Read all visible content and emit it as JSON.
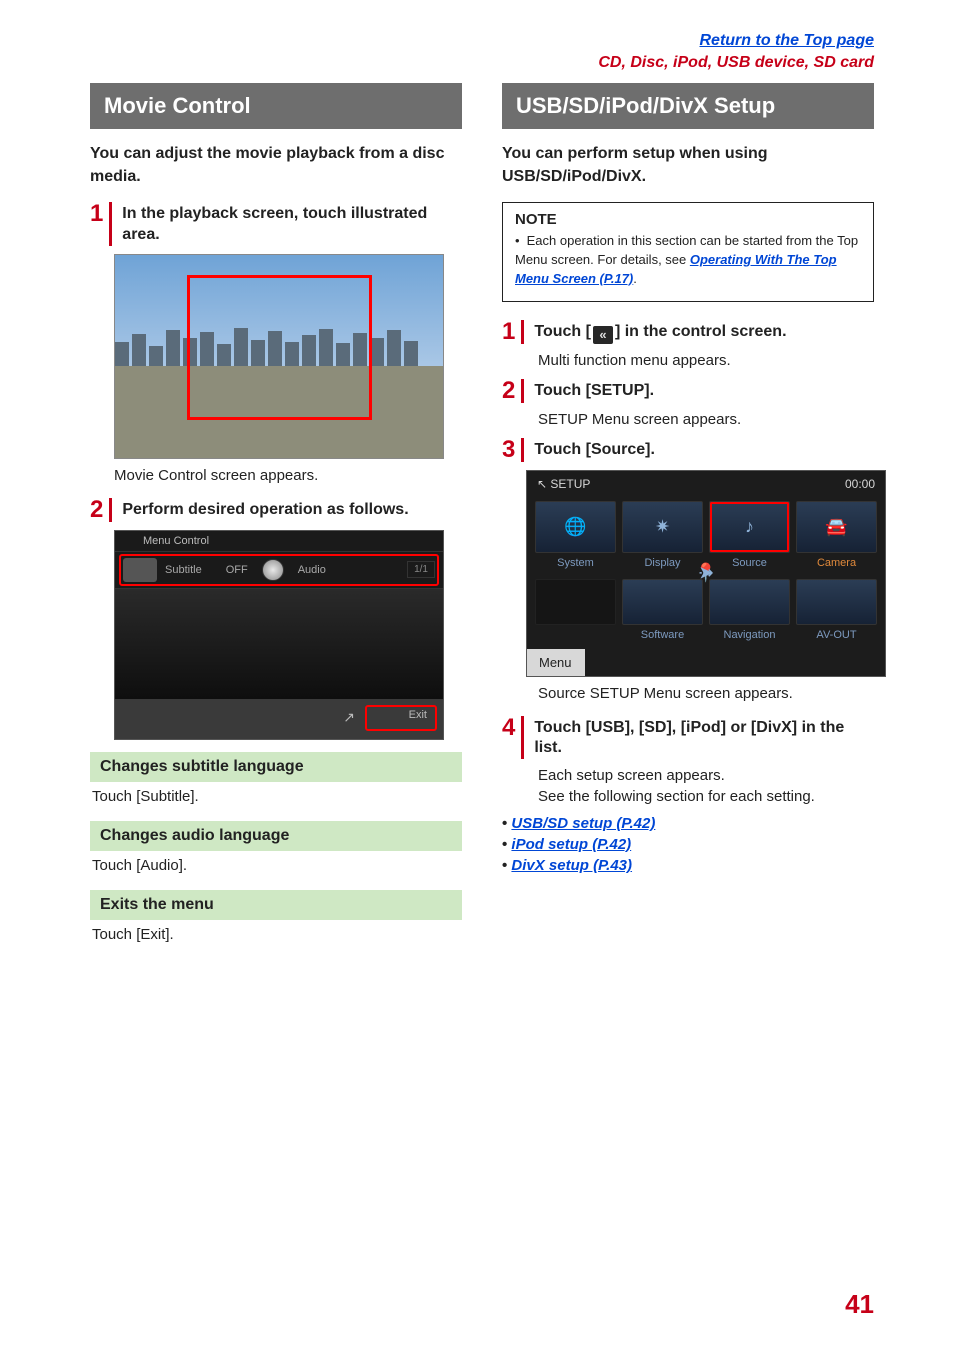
{
  "top": {
    "return_link": "Return to the Top page",
    "breadcrumb": "CD, Disc, iPod, USB device, SD card"
  },
  "left": {
    "title": "Movie Control",
    "intro": "You can adjust the movie playback from a disc media.",
    "step1": "In the playback screen, touch illustrated area.",
    "caption1": "Movie Control screen appears.",
    "step2": "Perform desired operation as follows.",
    "menu_shot": {
      "header": "Menu Control",
      "subtitle_label": "Subtitle",
      "off_label": "OFF",
      "audio_label": "Audio",
      "page": "1/1",
      "exit_label": "Exit",
      "icon_label": "↗"
    },
    "green": {
      "sub_h": "Changes subtitle language",
      "sub_b": "Touch [Subtitle].",
      "aud_h": "Changes audio language",
      "aud_b": "Touch [Audio].",
      "exit_h": "Exits the menu",
      "exit_b": "Touch [Exit]."
    }
  },
  "right": {
    "title": "USB/SD/iPod/DivX Setup",
    "intro": "You can perform setup when using USB/SD/iPod/DivX.",
    "note_title": "NOTE",
    "note_body_pre": "Each operation in this section can be started from the Top Menu screen. For details, see ",
    "note_link": "Operating With The Top Menu Screen (P.17)",
    "note_body_post": ".",
    "step1_pre": "Touch [",
    "step1_icon": "«",
    "step1_post": "] in the control screen.",
    "step1_sub": "Multi function menu appears.",
    "step2": "Touch [SETUP].",
    "step2_sub": "SETUP Menu screen appears.",
    "step3": "Touch [Source].",
    "setup_shot": {
      "title": "SETUP",
      "time": "00:00",
      "row1": [
        "System",
        "Display",
        "Source",
        "Camera"
      ],
      "row2": [
        "Software",
        "Navigation",
        "AV-OUT",
        ""
      ],
      "menu_btn": "Menu",
      "icons": {
        "display": "✷",
        "source": "♪",
        "camera": "🚘",
        "nav": "➤",
        "avout": "⇢",
        "system": "🌐",
        "software": "📍"
      }
    },
    "setup_caption": "Source SETUP Menu screen appears.",
    "step4": "Touch [USB], [SD], [iPod] or [DivX] in the list.",
    "step4_sub1": "Each setup screen appears.",
    "step4_sub2": "See the following section for each setting.",
    "links": {
      "usb": "USB/SD setup (P.42)",
      "ipod": "iPod setup (P.42)",
      "divx": "DivX setup (P.43)"
    }
  },
  "page_number": "41"
}
